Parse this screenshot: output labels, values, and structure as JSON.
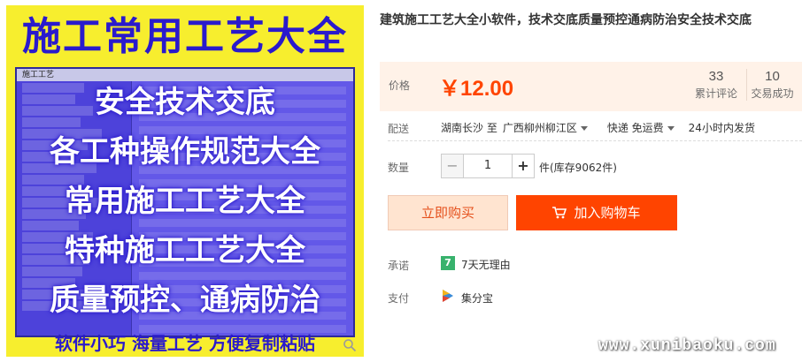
{
  "product_image": {
    "headline": "施工常用工艺大全",
    "window_title": "施工工艺",
    "overlay_lines": [
      "安全技术交底",
      "各工种操作规范大全",
      "常用施工工艺大全",
      "特种施工工艺大全",
      "质量预控、通病防治"
    ],
    "footer": "软件小巧  海量工艺  方便复制粘贴",
    "zoom_icon": "magnifier-icon"
  },
  "product": {
    "title": "建筑施工工艺大全小软件，技术交底质量预控通病防治安全技术交底"
  },
  "price": {
    "label": "价格",
    "value": "￥12.00",
    "reviews_count": "33",
    "reviews_label": "累计评论",
    "deals_count": "10",
    "deals_label": "交易成功"
  },
  "shipping": {
    "label": "配送",
    "from": "湖南长沙 至",
    "to": "广西柳州柳江区",
    "method": "快递 免运费",
    "dispatch": "24小时内发货"
  },
  "quantity": {
    "label": "数量",
    "value": "1",
    "minus": "−",
    "plus": "+",
    "stock": "件(库存9062件)"
  },
  "actions": {
    "buy_now": "立即购买",
    "add_to_cart": "加入购物车"
  },
  "promise": {
    "label": "承诺",
    "icon_text": "7",
    "text": "7天无理由"
  },
  "payment": {
    "label": "支付",
    "text": "集分宝"
  },
  "watermark": "www.xunibaoku.com",
  "colors": {
    "accent": "#ff4400",
    "price_bg": "#fff2e8",
    "image_bg": "#f7ee2e",
    "image_text": "#2a1acc"
  }
}
